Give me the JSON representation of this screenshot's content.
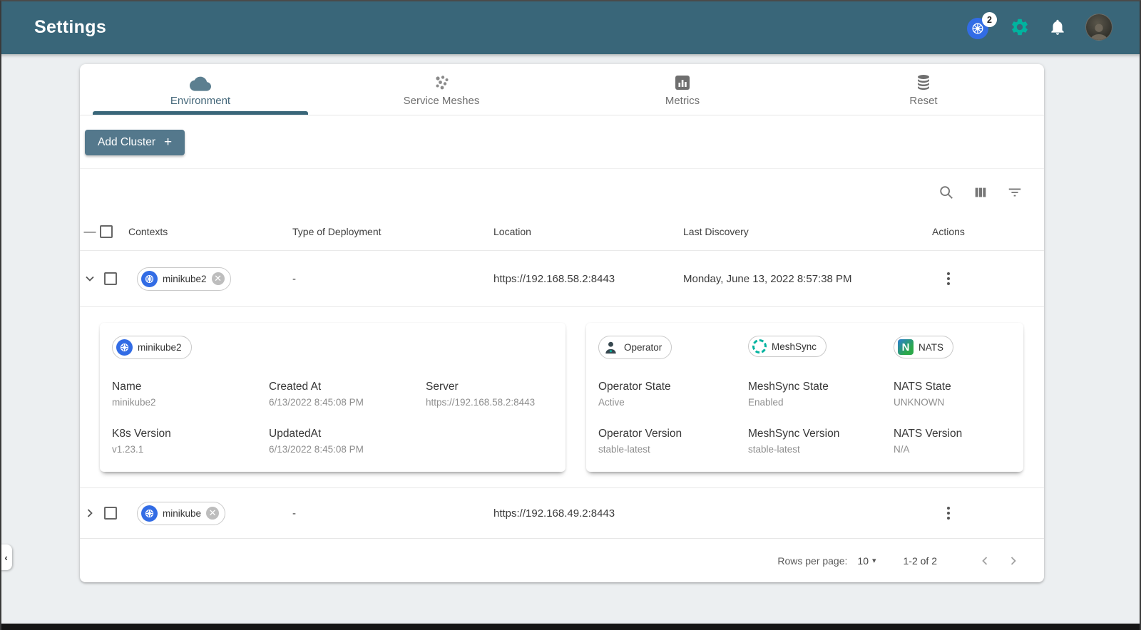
{
  "app": {
    "title": "Settings"
  },
  "header": {
    "kubernetes_badge_count": "2",
    "icons": [
      "kubernetes-icon",
      "gear-icon",
      "bell-icon",
      "avatar"
    ],
    "colors": {
      "bar": "#396679",
      "gear_green": "#00B39F",
      "k8s_blue": "#326CE5",
      "button": "#54788c"
    }
  },
  "tabs": [
    {
      "label": "Environment",
      "icon": "cloud-icon",
      "active": true
    },
    {
      "label": "Service Meshes",
      "icon": "mesh-icon",
      "active": false
    },
    {
      "label": "Metrics",
      "icon": "bar-chart-icon",
      "active": false
    },
    {
      "label": "Reset",
      "icon": "database-icon",
      "active": false
    }
  ],
  "toolbar": {
    "add_cluster_label": "Add Cluster",
    "add_cluster_plus": "+",
    "icons": [
      "search-icon",
      "view-columns-icon",
      "filter-icon"
    ]
  },
  "table": {
    "columns": {
      "contexts": "Contexts",
      "type": "Type of Deployment",
      "location": "Location",
      "discovery": "Last Discovery",
      "actions": "Actions"
    },
    "rows": [
      {
        "name": "minikube2",
        "deployment_type": "-",
        "location": "https://192.168.58.2:8443",
        "last_discovery": "Monday, June 13, 2022 8:57:38 PM",
        "expanded": true
      },
      {
        "name": "minikube",
        "deployment_type": "-",
        "location": "https://192.168.49.2:8443",
        "last_discovery": "",
        "expanded": false
      }
    ]
  },
  "details": {
    "cluster": {
      "chip": "minikube2",
      "fields": [
        {
          "label": "Name",
          "value": "minikube2"
        },
        {
          "label": "Created At",
          "value": "6/13/2022 8:45:08 PM"
        },
        {
          "label": "Server",
          "value": "https://192.168.58.2:8443"
        },
        {
          "label": "K8s Version",
          "value": "v1.23.1"
        },
        {
          "label": "UpdatedAt",
          "value": "6/13/2022 8:45:08 PM"
        }
      ]
    },
    "operator": {
      "chips": [
        {
          "label": "Operator",
          "icon": "operator-icon"
        },
        {
          "label": "MeshSync",
          "icon": "meshsync-icon"
        },
        {
          "label": "NATS",
          "icon": "nats-icon",
          "icon_letter": "N"
        }
      ],
      "fields": [
        {
          "label": "Operator State",
          "value": "Active"
        },
        {
          "label": "MeshSync State",
          "value": "Enabled"
        },
        {
          "label": "NATS State",
          "value": "UNKNOWN"
        },
        {
          "label": "Operator Version",
          "value": "stable-latest"
        },
        {
          "label": "MeshSync Version",
          "value": "stable-latest"
        },
        {
          "label": "NATS Version",
          "value": "N/A"
        }
      ]
    }
  },
  "pagination": {
    "rows_per_page_label": "Rows per page:",
    "rows_per_page_value": "10",
    "range": "1-2 of 2"
  }
}
